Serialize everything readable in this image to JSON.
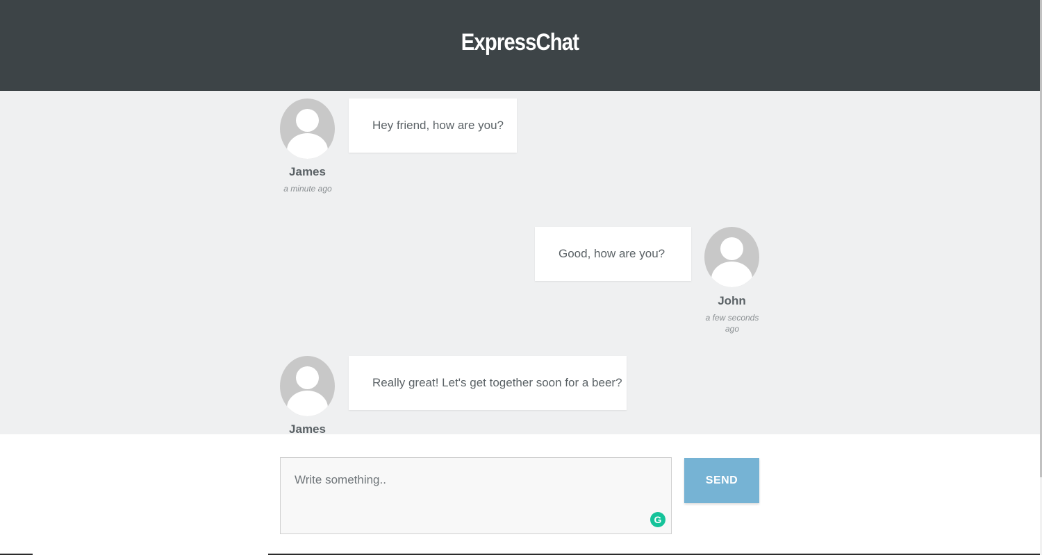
{
  "app": {
    "title": "ExpressChat"
  },
  "messages": [
    {
      "author": "James",
      "text": "Hey friend, how are you?",
      "time": "a minute ago",
      "side": "left"
    },
    {
      "author": "John",
      "text": "Good, how are you?",
      "time": "a few seconds ago",
      "side": "right"
    },
    {
      "author": "James",
      "text": "Really great! Let's get together soon for a beer?",
      "time": "",
      "side": "left"
    }
  ],
  "composer": {
    "placeholder": "Write something..",
    "value": "",
    "send_label": "SEND"
  },
  "icons": {
    "avatar": "user-avatar-icon",
    "grammarly": "grammarly-icon"
  },
  "colors": {
    "header_bg": "#3d4447",
    "chat_bg": "#eff0f1",
    "send_button": "#76b3d4",
    "grammarly": "#15c39a"
  }
}
